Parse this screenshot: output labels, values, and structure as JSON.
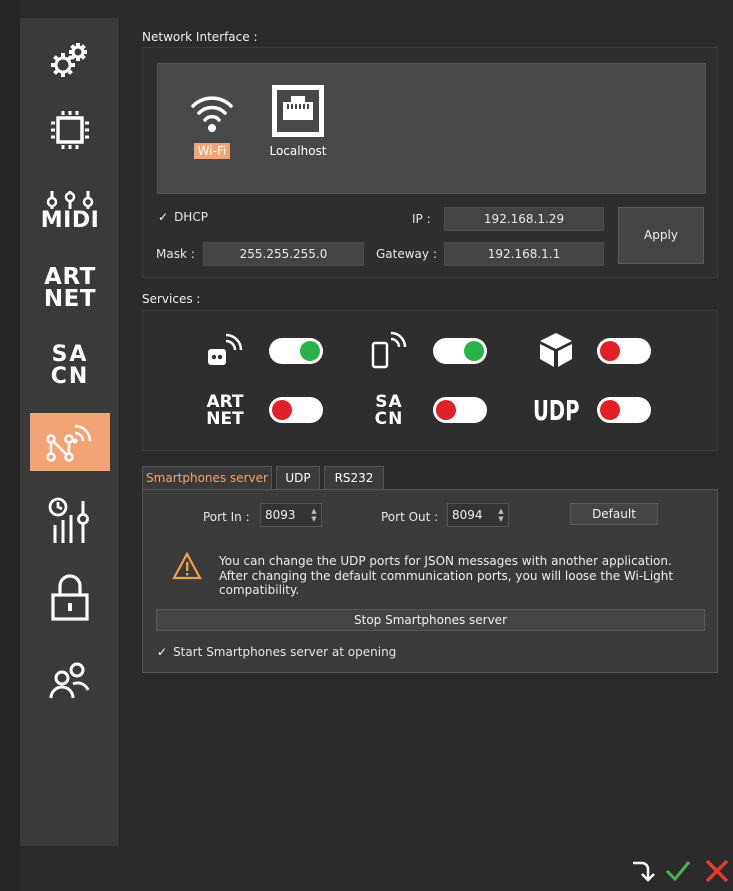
{
  "sidebar": {
    "items": [
      {
        "name": "settings",
        "icon": "gears-icon"
      },
      {
        "name": "hardware",
        "icon": "chip-icon"
      },
      {
        "name": "midi",
        "label": "MIDI",
        "icon": "faders-icon"
      },
      {
        "name": "artnet",
        "label_top": "ART",
        "label_bottom": "NET"
      },
      {
        "name": "sacn",
        "label_top": "SA",
        "label_bottom": "CN"
      },
      {
        "name": "network",
        "icon": "network-icon",
        "active": true
      },
      {
        "name": "timing",
        "icon": "timer-faders-icon"
      },
      {
        "name": "security",
        "icon": "lock-icon"
      },
      {
        "name": "users",
        "icon": "users-icon"
      }
    ],
    "active_color": "#f2a477"
  },
  "network": {
    "title": "Network Interface :",
    "interfaces": [
      {
        "label": "Wi-Fi",
        "icon": "wifi-icon",
        "selected": true
      },
      {
        "label": "Localhost",
        "icon": "ethernet-port-icon",
        "selected": false
      }
    ],
    "dhcp_label": "DHCP",
    "dhcp_checked": true,
    "ip_label": "IP :",
    "ip_value": "192.168.1.29",
    "mask_label": "Mask :",
    "mask_value": "255.255.255.0",
    "gateway_label": "Gateway :",
    "gateway_value": "192.168.1.1",
    "apply_label": "Apply"
  },
  "services": {
    "title": "Services :",
    "items": [
      {
        "name": "remote",
        "icon": "remote-icon",
        "on": true
      },
      {
        "name": "smartphone",
        "icon": "smartphone-icon",
        "on": true
      },
      {
        "name": "box",
        "icon": "cube-icon",
        "on": false
      },
      {
        "name": "artnet",
        "label_top": "ART",
        "label_bottom": "NET",
        "on": false
      },
      {
        "name": "sacn",
        "label_top": "SA",
        "label_bottom": "CN",
        "on": false
      },
      {
        "name": "udp",
        "label": "UDP",
        "on": false
      }
    ],
    "on_color": "#2ab24a",
    "off_color": "#e11f26"
  },
  "tabs": [
    {
      "label": "Smartphones server",
      "active": true
    },
    {
      "label": "UDP",
      "active": false
    },
    {
      "label": "RS232",
      "active": false
    }
  ],
  "server": {
    "port_in_label": "Port In :",
    "port_in_value": "8093",
    "port_out_label": "Port Out :",
    "port_out_value": "8094",
    "default_label": "Default",
    "warning_line1": "You can change the UDP ports for JSON messages with another application.",
    "warning_line2": "After changing the default communication ports, you will loose the Wi-Light compatibility.",
    "stop_label": "Stop Smartphones server",
    "start_at_opening_label": "Start Smartphones server at opening",
    "start_at_opening_checked": true
  },
  "footer": {
    "icons": [
      "next-icon",
      "confirm-icon",
      "close-icon"
    ],
    "confirm_color": "#4caf50",
    "close_color": "#e53935"
  }
}
